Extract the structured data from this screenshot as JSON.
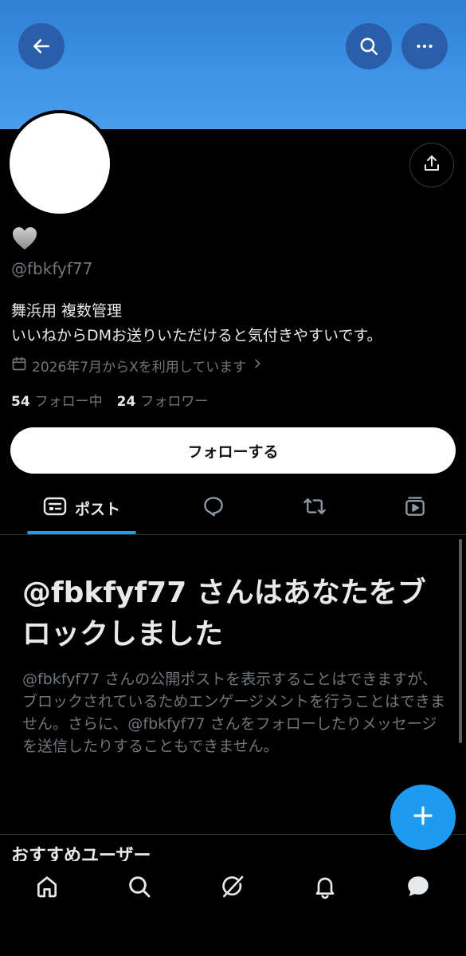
{
  "profile": {
    "handle": "@fbkfyf77",
    "bio_line1": "舞浜用 複数管理",
    "bio_line2": "いいねからDMお送りいただけると気付きやすいです。",
    "joined": "2026年7月からXを利用しています",
    "following_count": "54",
    "following_label": "フォロー中",
    "followers_count": "24",
    "followers_label": "フォロワー",
    "heart_icon": "grey-heart-icon"
  },
  "follow_button": {
    "label": "フォローする"
  },
  "tabs": [
    {
      "label": "ポスト",
      "icon": "posts-icon",
      "active": true
    },
    {
      "label": "",
      "icon": "replies-icon",
      "active": false
    },
    {
      "label": "",
      "icon": "repost-icon",
      "active": false
    },
    {
      "label": "",
      "icon": "media-icon",
      "active": false
    }
  ],
  "blocked": {
    "title": "@fbkfyf77 さんはあなたをブロックしました",
    "text": "@fbkfyf77 さんの公開ポストを表示することはできますが、ブロックされているためエンゲージメントを行うことはできません。さらに、@fbkfyf77 さんをフォローしたりメッセージを送信したりすることもできません。"
  },
  "suggestions": {
    "heading": "おすすめユーザー"
  },
  "bottom_nav": [
    {
      "icon": "home-icon"
    },
    {
      "icon": "search-icon"
    },
    {
      "icon": "grok-icon"
    },
    {
      "icon": "notifications-icon"
    },
    {
      "icon": "messages-icon"
    }
  ],
  "colors": {
    "accent": "#1d9bf0",
    "banner": "#3f94e6",
    "muted_text": "#71767b",
    "primary_text": "#e7e9ea"
  }
}
